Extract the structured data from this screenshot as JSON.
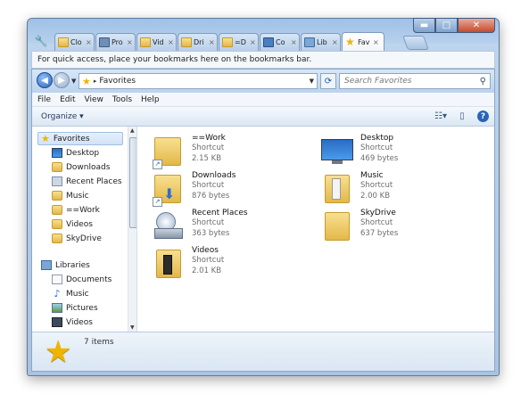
{
  "tabs": [
    {
      "label": "Clo",
      "icon": "folder-icon",
      "color": "#e8c060"
    },
    {
      "label": "Pro",
      "icon": "computer-icon",
      "color": "#6f8fb8"
    },
    {
      "label": "Vid",
      "icon": "folder-icon",
      "color": "#e8c060"
    },
    {
      "label": "Dri",
      "icon": "folder-icon",
      "color": "#e8c060"
    },
    {
      "label": "=D",
      "icon": "folder-icon",
      "color": "#e8c060"
    },
    {
      "label": "Co",
      "icon": "network-icon",
      "color": "#4a7fc0"
    },
    {
      "label": "Lib",
      "icon": "library-icon",
      "color": "#7aa6d8"
    },
    {
      "label": "Fav",
      "icon": "star-icon",
      "color": "#f0b400"
    }
  ],
  "tab_close_glyph": "×",
  "window_buttons": {
    "minimize": "▬",
    "maximize": "□",
    "close": "✕"
  },
  "bookmarks_bar_text": "For quick access, place your bookmarks here on the bookmarks bar.",
  "address": {
    "breadcrumb": "Favorites",
    "separator": "▸"
  },
  "search": {
    "placeholder": "Search Favorites"
  },
  "menu": [
    "File",
    "Edit",
    "View",
    "Tools",
    "Help"
  ],
  "toolbar": {
    "organize_label": "Organize ▾"
  },
  "nav": {
    "favorites_header": "Favorites",
    "favorites": [
      "Desktop",
      "Downloads",
      "Recent Places",
      "Music",
      "==Work",
      "Videos",
      "SkyDrive"
    ],
    "libraries_header": "Libraries",
    "libraries": [
      "Documents",
      "Music",
      "Pictures",
      "Videos"
    ]
  },
  "files": [
    {
      "name": "==Work",
      "type": "Shortcut",
      "size": "2.15 KB",
      "icon": "folder-shortcut-icon"
    },
    {
      "name": "Desktop",
      "type": "Shortcut",
      "size": "469 bytes",
      "icon": "desktop-icon"
    },
    {
      "name": "Downloads",
      "type": "Shortcut",
      "size": "876 bytes",
      "icon": "downloads-folder-icon"
    },
    {
      "name": "Music",
      "type": "Shortcut",
      "size": "2.00 KB",
      "icon": "music-folder-icon"
    },
    {
      "name": "Recent Places",
      "type": "Shortcut",
      "size": "363 bytes",
      "icon": "recent-places-icon"
    },
    {
      "name": "SkyDrive",
      "type": "Shortcut",
      "size": "637 bytes",
      "icon": "skydrive-folder-icon"
    },
    {
      "name": "Videos",
      "type": "Shortcut",
      "size": "2.01 KB",
      "icon": "videos-folder-icon"
    }
  ],
  "status": {
    "item_count": "7 items"
  }
}
